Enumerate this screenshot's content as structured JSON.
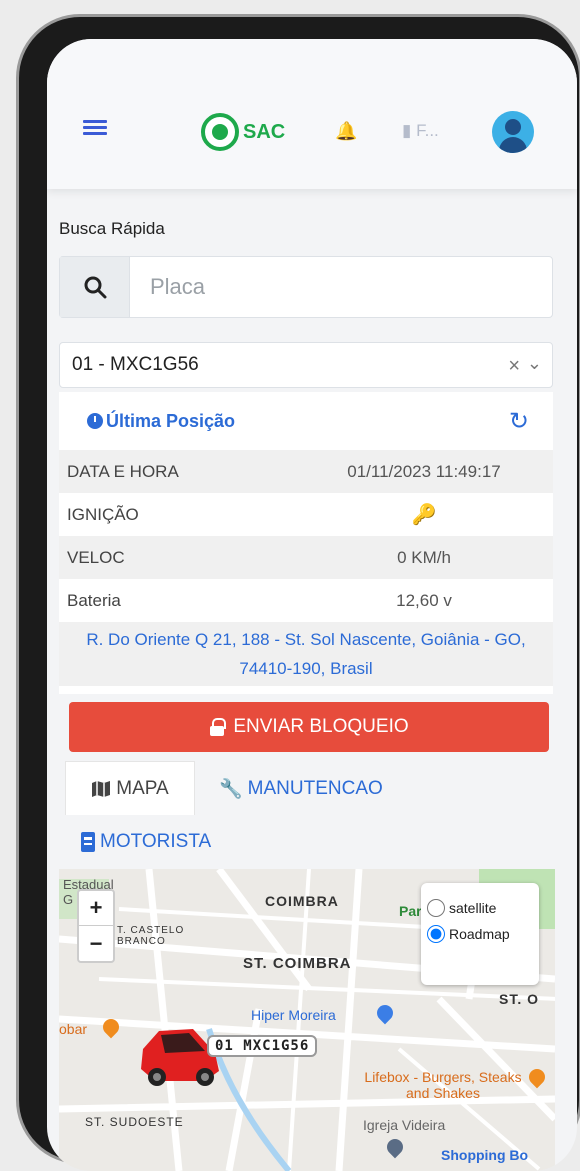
{
  "header": {
    "sac_label": "SAC",
    "favorites_label": "F..."
  },
  "search": {
    "section_label": "Busca Rápida",
    "placeholder": "Placa"
  },
  "vehicle_select": {
    "selected": "01 - MXC1G56"
  },
  "last_position": {
    "title": "Última Posição",
    "rows": [
      {
        "label": "DATA E HORA",
        "value": "01/11/2023 11:49:17"
      },
      {
        "label": "IGNIÇÃO",
        "value": ""
      },
      {
        "label": "VELOC",
        "value": "0 KM/h"
      },
      {
        "label": "Bateria",
        "value": "12,60 v"
      }
    ],
    "address": "R. Do Oriente Q 21, 188 - St. Sol Nascente, Goiânia - GO, 74410-190, Brasil"
  },
  "block_button_label": "ENVIAR BLOQUEIO",
  "tabs": [
    {
      "label": "MAPA"
    },
    {
      "label": "MANUTENCAO"
    },
    {
      "label": "MOTORISTA"
    }
  ],
  "map": {
    "zoom_in": "+",
    "zoom_out": "−",
    "type_options": [
      "satellite",
      "Roadmap"
    ],
    "selected_type": "Roadmap",
    "labels": {
      "estadual": "Estadual G",
      "coimbra": "COIMBRA",
      "parque": "Parqu",
      "castelo_branco": "T. CASTELO BRANCO",
      "st_coimbra": "ST. COIMBRA",
      "st_o": "ST. O",
      "hiper_moreira": "Hiper Moreira",
      "bar": "obar",
      "lifebox": "Lifebox - Burgers, Steaks and Shakes",
      "st_sudoeste": "ST. SUDOESTE",
      "igreja": "Igreja Videira",
      "shopping": "Shopping Bo"
    },
    "vehicle_plate": "01 MXC1G56",
    "colors": {
      "car": "#e02020",
      "water": "#a9d3f2",
      "park": "#bfe3b4"
    }
  },
  "colors": {
    "primary": "#2c6bd6",
    "danger": "#e74c3c",
    "whatsapp": "#1ea94b"
  },
  "icons": [
    "menu-icon",
    "whatsapp-icon",
    "bell-icon",
    "bookmark-icon",
    "user-avatar-icon",
    "search-icon",
    "clear-icon",
    "chevron-down-icon",
    "clock-icon",
    "refresh-icon",
    "key-icon",
    "lock-icon",
    "map-icon",
    "wrench-icon",
    "id-card-icon",
    "car-icon"
  ]
}
